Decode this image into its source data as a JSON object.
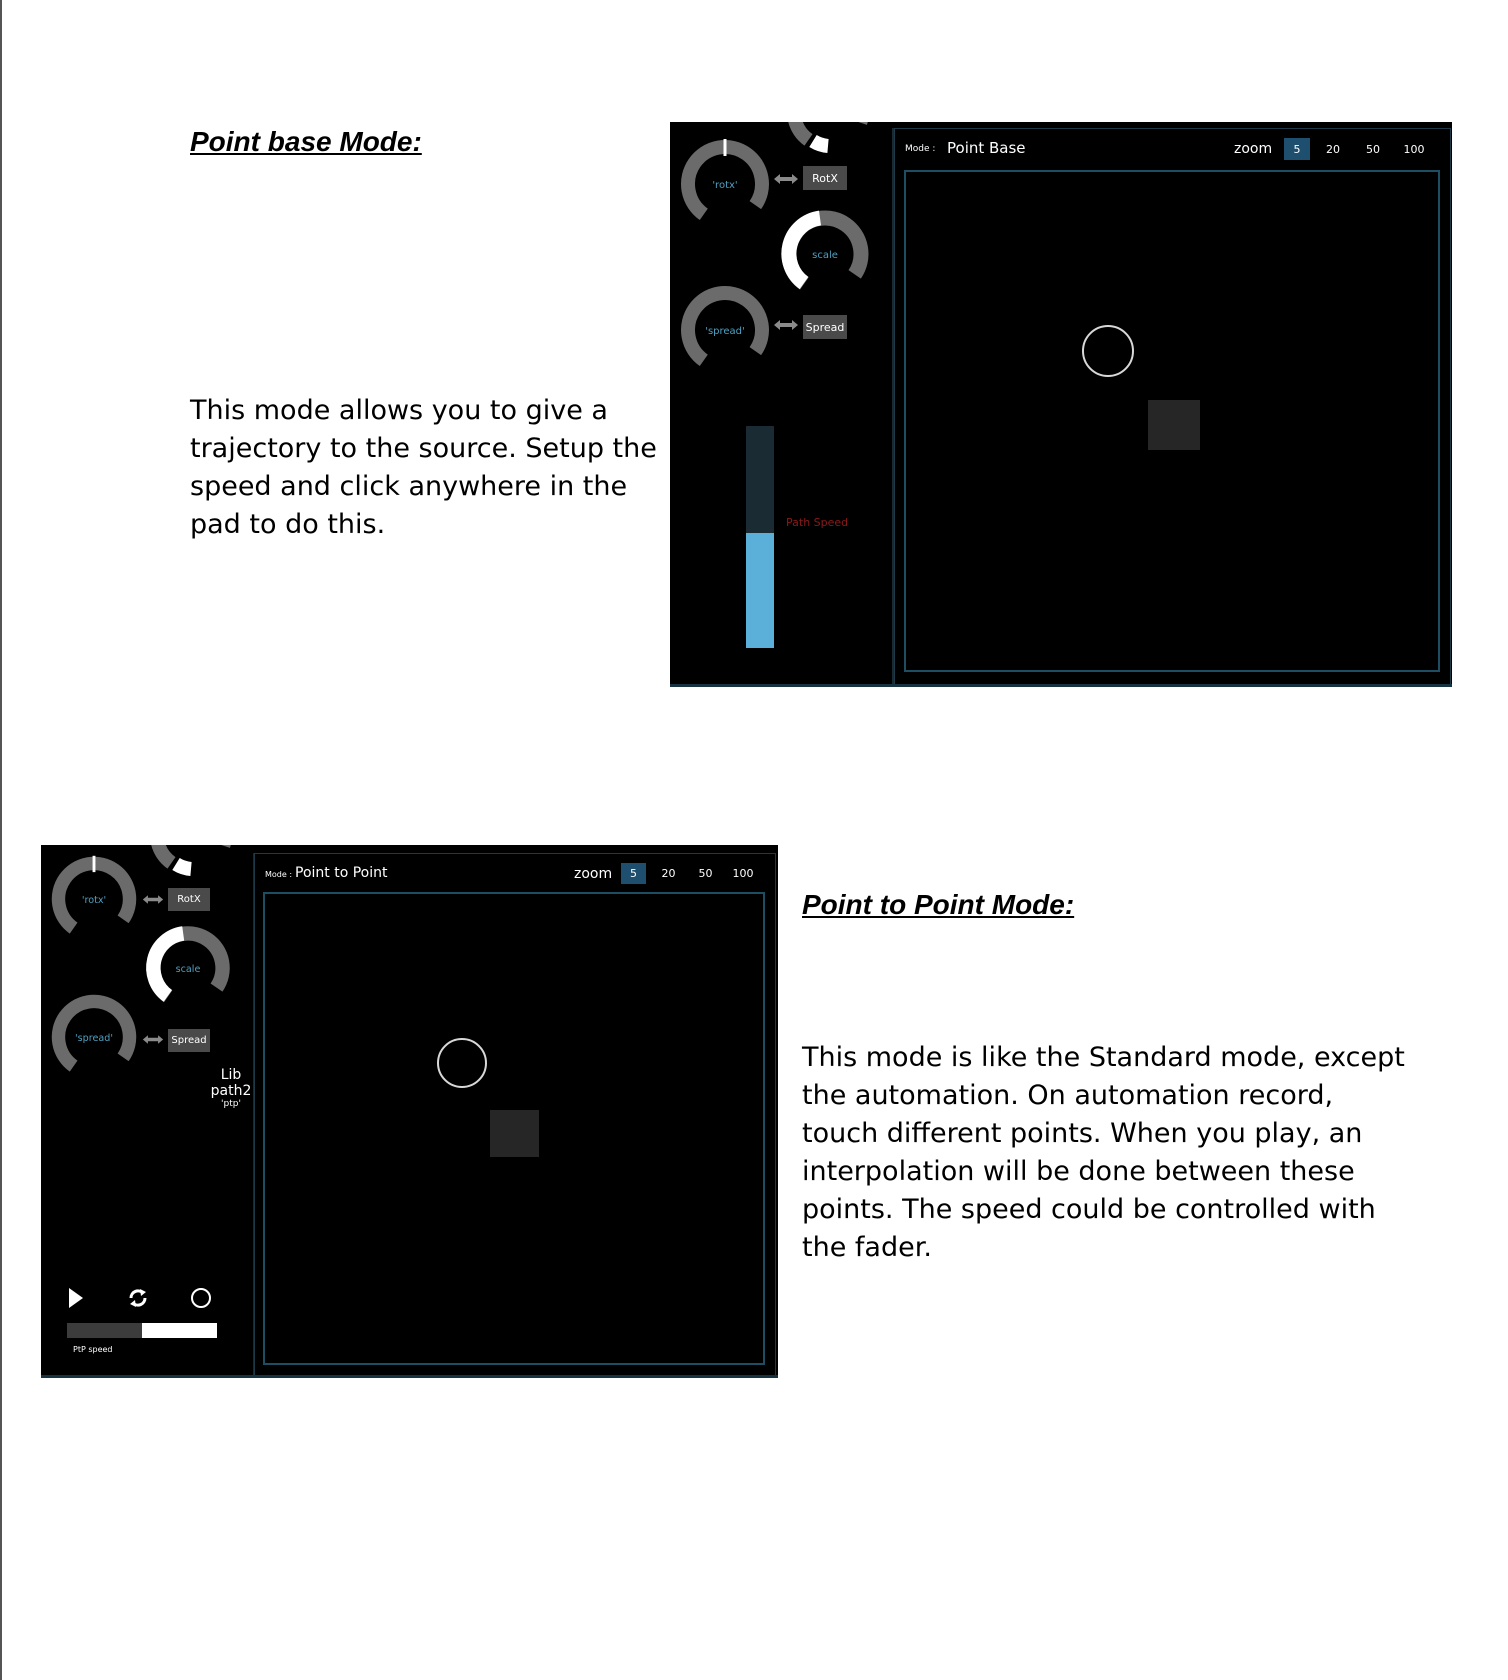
{
  "section1": {
    "heading": "Point base Mode:",
    "body": [
      "This mode allows you to give a",
      "trajectory to the source. Setup the",
      "speed and click anywhere in the",
      "pad to do this."
    ],
    "shot": {
      "knob_rotx": "'rotx'",
      "tag_rotx": "RotX",
      "knob_scale": "scale",
      "knob_spread": "'spread'",
      "tag_spread": "Spread",
      "fader_label": "Path Speed",
      "fader_value_fraction": 0.52,
      "mode_label": "Mode :",
      "mode_name": "Point Base",
      "zoom_label": "zoom",
      "zoom_options": [
        "5",
        "20",
        "50",
        "100"
      ],
      "zoom_selected": "5"
    }
  },
  "section2": {
    "heading": "Point to Point Mode:",
    "body": [
      "This mode is like the Standard mode, except",
      "the automation. On automation record,",
      "touch different points. When you play, an",
      "interpolation will be done between these",
      "points. The speed could be controlled with",
      "the fader."
    ],
    "shot": {
      "knob_rotx": "'rotx'",
      "tag_rotx": "RotX",
      "knob_scale": "scale",
      "knob_spread": "'spread'",
      "tag_spread": "Spread",
      "lib_line1": "Lib",
      "lib_line2": "path2",
      "lib_line3": "'ptp'",
      "speed_label": "PtP speed",
      "speed_value_fraction": 0.5,
      "mode_label": "Mode :",
      "mode_name": "Point to Point",
      "zoom_label": "zoom",
      "zoom_options": [
        "5",
        "20",
        "50",
        "100"
      ],
      "zoom_selected": "5"
    }
  },
  "colors": {
    "knob_track": "#6b6b6b",
    "knob_active": "#ffffff",
    "knob_label": "#4fa0c0",
    "fader_fill": "#5ab0d8",
    "fader_track": "#1b2b33",
    "fader_label": "#8b1a1a",
    "zoom_active": "#1f4f6e"
  }
}
